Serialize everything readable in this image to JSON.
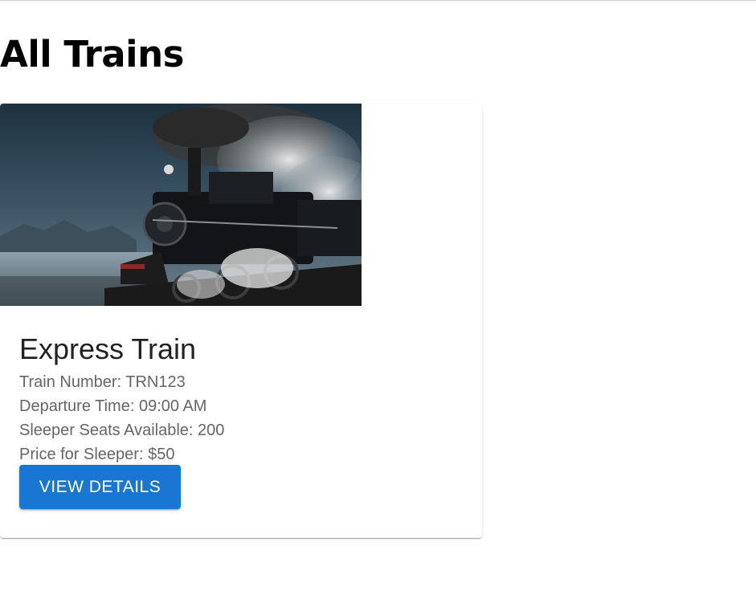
{
  "page": {
    "title": "All Trains"
  },
  "train": {
    "name": "Express Train",
    "number_line": "Train Number: TRN123",
    "departure_line": "Departure Time: 09:00 AM",
    "sleeper_line": "Sleeper Seats Available: 200",
    "price_line": "Price for Sleeper: $50",
    "button_label": "VIEW DETAILS"
  },
  "colors": {
    "button": "#1976d2",
    "text_secondary": "#666666"
  }
}
